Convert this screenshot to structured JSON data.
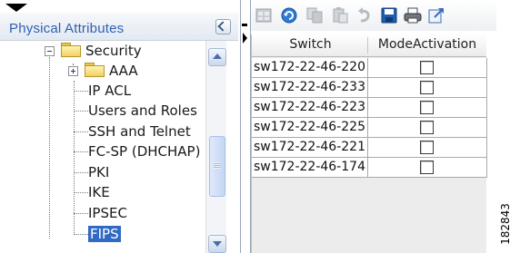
{
  "left_panel": {
    "header_title": "Physical Attributes"
  },
  "tree": {
    "items": [
      {
        "label": "Security",
        "expander": "minus",
        "icon": "folder-icon",
        "selected": false
      },
      {
        "label": "AAA",
        "expander": "plus",
        "icon": "folder-icon",
        "selected": false
      },
      {
        "label": "IP ACL",
        "selected": false
      },
      {
        "label": "Users and Roles",
        "selected": false
      },
      {
        "label": "SSH and Telnet",
        "selected": false
      },
      {
        "label": "FC-SP (DHCHAP)",
        "selected": false
      },
      {
        "label": "PKI",
        "selected": false
      },
      {
        "label": "IKE",
        "selected": false
      },
      {
        "label": "IPSEC",
        "selected": false
      },
      {
        "label": "FIPS",
        "selected": true
      }
    ]
  },
  "toolbar": {
    "icons": [
      "refresh-disabled-icon",
      "refresh-icon",
      "copy-disabled-icon",
      "paste-disabled-icon",
      "undo-disabled-icon",
      "save-icon",
      "print-icon",
      "export-icon"
    ]
  },
  "table": {
    "columns": [
      "Switch",
      "ModeActivation"
    ],
    "rows": [
      {
        "switch": "sw172-22-46-220",
        "mode_activation": false
      },
      {
        "switch": "sw172-22-46-233",
        "mode_activation": false
      },
      {
        "switch": "sw172-22-46-223",
        "mode_activation": false
      },
      {
        "switch": "sw172-22-46-225",
        "mode_activation": false
      },
      {
        "switch": "sw172-22-46-221",
        "mode_activation": false
      },
      {
        "switch": "sw172-22-46-174",
        "mode_activation": false
      }
    ]
  },
  "figure_number": "182843",
  "colors": {
    "header_title": "#2b61b4",
    "selection": "#3169c6",
    "folder": "#f2d261"
  }
}
